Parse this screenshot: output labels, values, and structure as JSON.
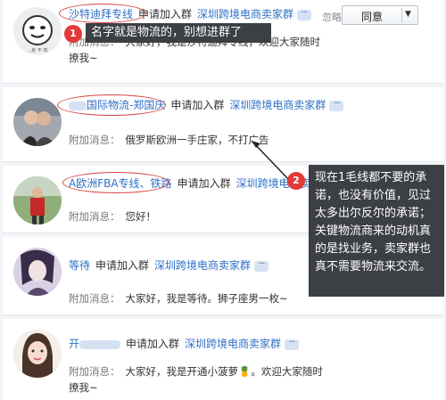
{
  "requests": [
    {
      "nickname": "沙特迪拜专线",
      "action": "申请加入群",
      "group": "深圳跨境电商卖家群",
      "label": "附加消息：",
      "message": "大家好，我是沙特迪拜专线，欢迎大家随时撩我~",
      "ignore": "忽略",
      "agree": "同意"
    },
    {
      "nickname": "国际物流-郑国庆",
      "action": "申请加入群",
      "group": "深圳跨境电商卖家群",
      "label": "附加消息：",
      "message": "俄罗斯欧洲一手庄家，不打广告"
    },
    {
      "nickname": "A欧洲FBA专线、铁路",
      "action": "申请加入群",
      "group": "深圳跨境电商卖...",
      "label": "附加消息：",
      "message": "您好！"
    },
    {
      "nickname": "等待",
      "action": "申请加入群",
      "group": "深圳跨境电商卖家群",
      "label": "附加消息：",
      "message": "大家好，我是等待。狮子座男一枚~"
    },
    {
      "nickname": "开",
      "action": "申请加入群",
      "group": "深圳跨境电商卖家群",
      "label": "附加消息：",
      "message": "大家好，我是开通小菠萝🍍。欢迎大家随时撩我~"
    }
  ],
  "annotations": {
    "one": {
      "badge": "1",
      "text": "名字就是物流的，别想进群了"
    },
    "two": {
      "badge": "2",
      "text": "现在1毛线都不要的承诺，也没有价值，见过太多出尔反尔的承诺；关键物流商来的动机真的是找业务，卖家群也真不需要物流来交流。"
    }
  },
  "colors": {
    "link": "#2f6fc4",
    "annotation_bg": "#3c3f44",
    "badge": "#e33a3a",
    "circle": "#d94040"
  }
}
